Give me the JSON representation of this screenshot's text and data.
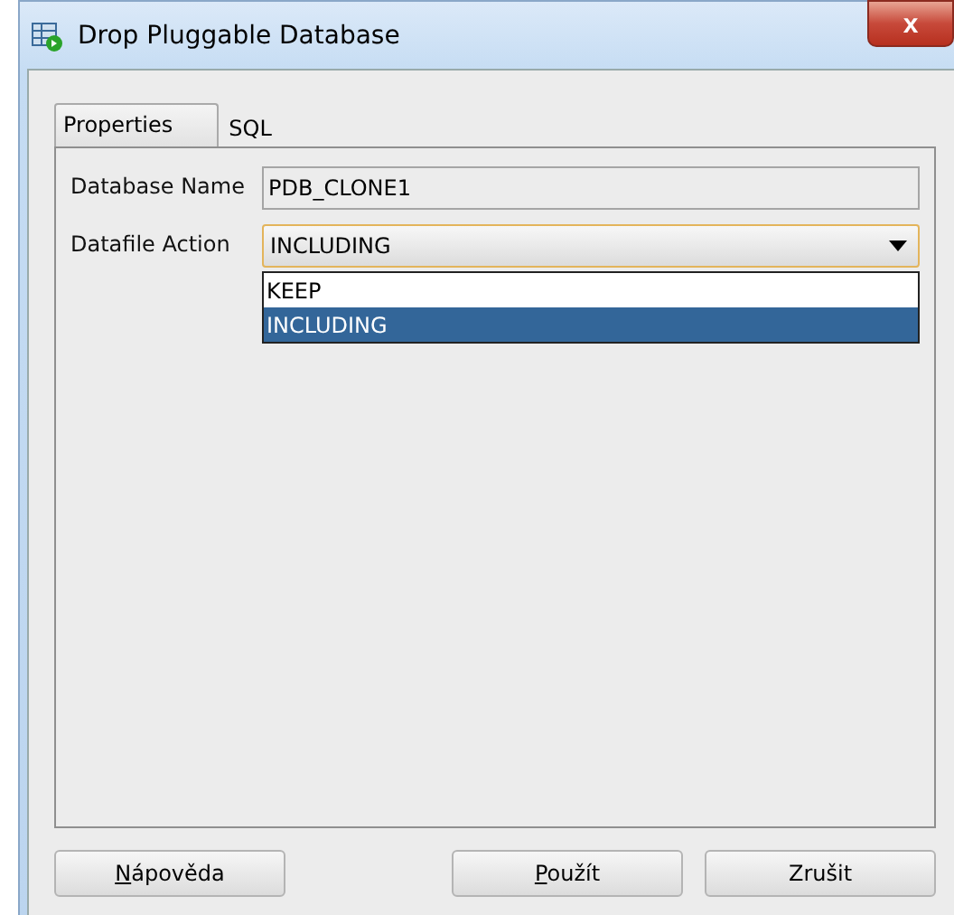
{
  "window": {
    "title": "Drop Pluggable Database",
    "close": "x"
  },
  "tabs": [
    {
      "label": "Properties",
      "selected": true
    },
    {
      "label": "SQL",
      "selected": false
    }
  ],
  "fields": [
    {
      "kind": "text",
      "label": "Database Name",
      "value": "PDB_CLONE1"
    },
    {
      "kind": "dropdown",
      "label": "Datafile Action",
      "value": "INCLUDING",
      "expanded": true,
      "options": [
        {
          "label": "KEEP",
          "selected": false
        },
        {
          "label": "INCLUDING",
          "selected": true
        }
      ]
    }
  ],
  "left_buttons": [
    {
      "label": "Nápověda",
      "mnemonic_first": true
    }
  ],
  "right_buttons": [
    {
      "label": "Použít",
      "mnemonic_first": true
    },
    {
      "label": "Zrušit",
      "mnemonic_first": false
    }
  ]
}
